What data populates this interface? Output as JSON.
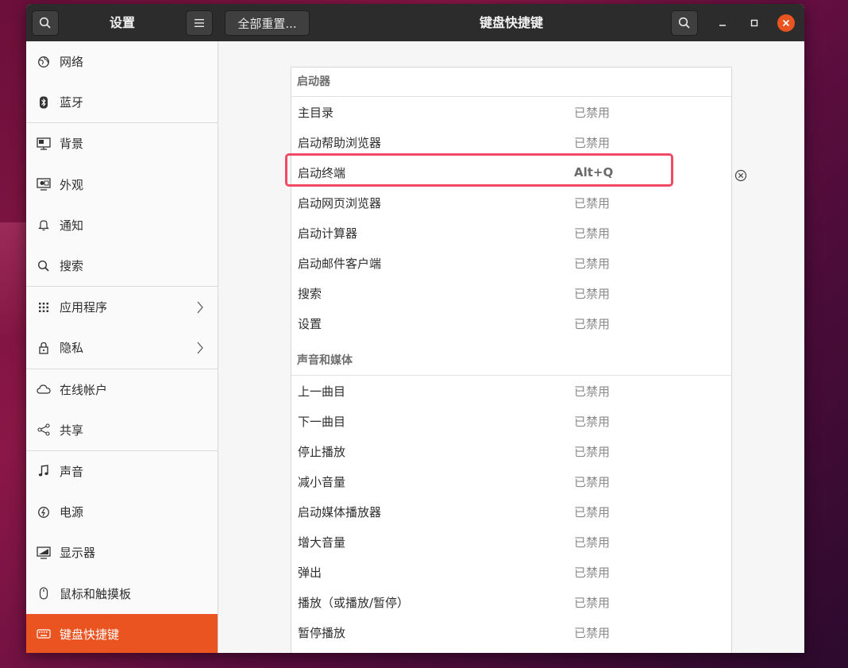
{
  "titlebar": {
    "left_title": "设置",
    "reset_label": "全部重置...",
    "main_title": "键盘快捷键"
  },
  "sidebar": {
    "items": [
      {
        "label": "网络",
        "icon": "network-icon"
      },
      {
        "label": "蓝牙",
        "icon": "bluetooth-icon"
      },
      {
        "label": "背景",
        "icon": "background-icon"
      },
      {
        "label": "外观",
        "icon": "appearance-icon"
      },
      {
        "label": "通知",
        "icon": "notification-bell-icon"
      },
      {
        "label": "搜索",
        "icon": "search-icon"
      },
      {
        "label": "应用程序",
        "icon": "apps-grid-icon"
      },
      {
        "label": "隐私",
        "icon": "lock-icon"
      },
      {
        "label": "在线帐户",
        "icon": "cloud-icon"
      },
      {
        "label": "共享",
        "icon": "share-icon"
      },
      {
        "label": "声音",
        "icon": "music-note-icon"
      },
      {
        "label": "电源",
        "icon": "power-icon"
      },
      {
        "label": "显示器",
        "icon": "display-icon"
      },
      {
        "label": "鼠标和触摸板",
        "icon": "mouse-icon"
      },
      {
        "label": "键盘快捷键",
        "icon": "keyboard-icon"
      }
    ]
  },
  "shortcuts": {
    "launchers": {
      "title": "启动器",
      "rows": [
        {
          "name": "主目录",
          "accel": "已禁用"
        },
        {
          "name": "启动帮助浏览器",
          "accel": "已禁用"
        },
        {
          "name": "启动终端",
          "accel": "Alt+Q"
        },
        {
          "name": "启动网页浏览器",
          "accel": "已禁用"
        },
        {
          "name": "启动计算器",
          "accel": "已禁用"
        },
        {
          "name": "启动邮件客户端",
          "accel": "已禁用"
        },
        {
          "name": "搜索",
          "accel": "已禁用"
        },
        {
          "name": "设置",
          "accel": "已禁用"
        }
      ]
    },
    "media": {
      "title": "声音和媒体",
      "rows": [
        {
          "name": "上一曲目",
          "accel": "已禁用"
        },
        {
          "name": "下一曲目",
          "accel": "已禁用"
        },
        {
          "name": "停止播放",
          "accel": "已禁用"
        },
        {
          "name": "减小音量",
          "accel": "已禁用"
        },
        {
          "name": "启动媒体播放器",
          "accel": "已禁用"
        },
        {
          "name": "增大音量",
          "accel": "已禁用"
        },
        {
          "name": "弹出",
          "accel": "已禁用"
        },
        {
          "name": "播放（或播放/暂停）",
          "accel": "已禁用"
        },
        {
          "name": "暂停播放",
          "accel": "已禁用"
        }
      ]
    }
  },
  "colors": {
    "accent": "#e95420",
    "highlight": "#f04a65",
    "titlebar": "#2c2c2c"
  }
}
